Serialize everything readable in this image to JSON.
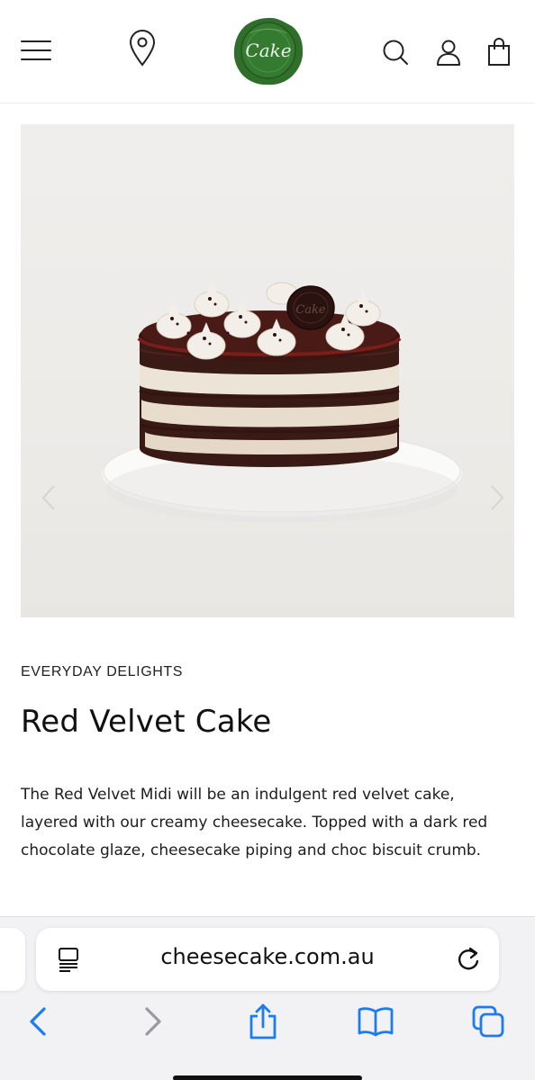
{
  "header": {
    "menu_icon": "hamburger-menu-icon",
    "location_icon": "map-pin-icon",
    "logo_text": "Cake",
    "logo_color": "#2e6b2a",
    "search_icon": "search-icon",
    "account_icon": "user-icon",
    "bag_icon": "shopping-bag-icon"
  },
  "hero": {
    "image": "red-velvet-cake-photo",
    "prev_icon": "chevron-left-icon",
    "next_icon": "chevron-right-icon"
  },
  "product": {
    "category": "EVERYDAY DELIGHTS",
    "title": "Red Velvet Cake",
    "description": "The Red Velvet Midi will be an indulgent red velvet cake, layered with our creamy cheesecake. Topped with a dark red chocolate glaze, cheesecake piping and choc biscuit crumb."
  },
  "browser": {
    "url": "cheesecake.com.au",
    "reader_icon": "reader-mode-icon",
    "reload_icon": "reload-icon",
    "toolbar": {
      "back_icon": "back-chevron-icon",
      "forward_icon": "forward-chevron-icon",
      "share_icon": "share-icon",
      "bookmarks_icon": "bookmarks-book-icon",
      "tabs_icon": "tabs-icon"
    },
    "accent_color": "#1a7cf0"
  }
}
